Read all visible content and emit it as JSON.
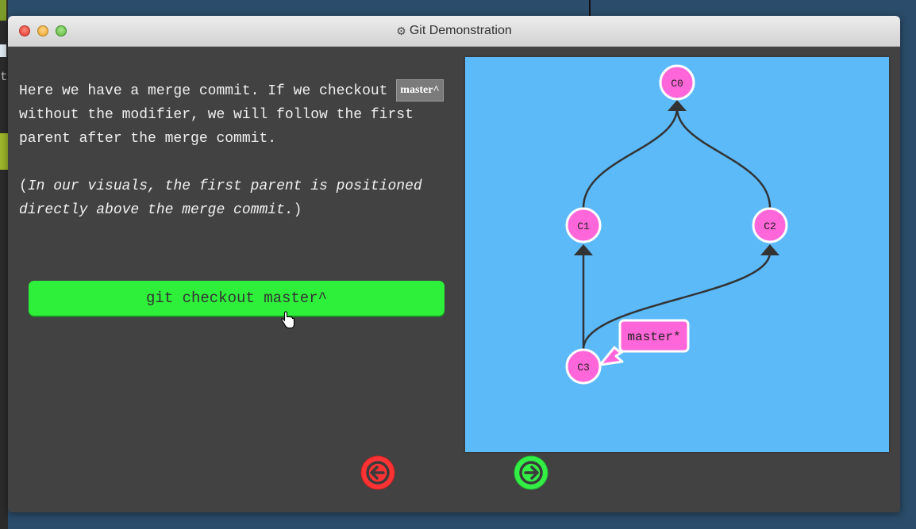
{
  "window": {
    "title": "Git Demonstration"
  },
  "background": {
    "edge_text": "t"
  },
  "explanation": {
    "line1_before": "Here we have a merge commit. If we checkout ",
    "code_ref": "master^",
    "line1_after": " without the modifier, we will follow the first parent after the merge commit.",
    "note_open": "(",
    "note_italic": "In our visuals, the first parent is positioned directly above the merge commit.",
    "note_close": ")"
  },
  "command_button": {
    "label": "git checkout master^"
  },
  "graph": {
    "commits": [
      {
        "id": "C0",
        "label": "C0"
      },
      {
        "id": "C1",
        "label": "C1"
      },
      {
        "id": "C2",
        "label": "C2"
      },
      {
        "id": "C3",
        "label": "C3"
      }
    ],
    "branch_label": "master*",
    "colors": {
      "canvas": "#5cbaf9",
      "commit_fill": "#ff66d9",
      "edge": "#333333"
    }
  },
  "navigation": {
    "prev_icon": "arrow-left-icon",
    "next_icon": "arrow-right-icon",
    "prev_color": "#ff3333",
    "next_color": "#33ee44"
  }
}
